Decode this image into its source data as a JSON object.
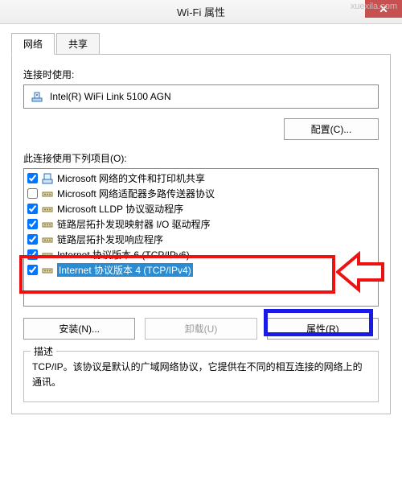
{
  "watermark": "xuexila.com",
  "titlebar": {
    "title": "Wi-Fi 属性"
  },
  "tabs": {
    "network": "网络",
    "sharing": "共享"
  },
  "connect_using_label": "连接时使用:",
  "adapter": {
    "name": "Intel(R) WiFi Link 5100 AGN"
  },
  "configure_btn": "配置(C)...",
  "items_label": "此连接使用下列项目(O):",
  "items": [
    {
      "checked": true,
      "label": "Microsoft 网络的文件和打印机共享",
      "icon": "share"
    },
    {
      "checked": false,
      "label": "Microsoft 网络适配器多路传送器协议",
      "icon": "proto"
    },
    {
      "checked": true,
      "label": "Microsoft LLDP 协议驱动程序",
      "icon": "proto"
    },
    {
      "checked": true,
      "label": "链路层拓扑发现映射器 I/O 驱动程序",
      "icon": "proto"
    },
    {
      "checked": true,
      "label": "链路层拓扑发现响应程序",
      "icon": "proto"
    },
    {
      "checked": true,
      "label": "Internet 协议版本 6 (TCP/IPv6)",
      "icon": "proto"
    },
    {
      "checked": true,
      "label": "Internet 协议版本 4 (TCP/IPv4)",
      "icon": "proto",
      "selected": true
    }
  ],
  "install_btn": "安装(N)...",
  "uninstall_btn": "卸载(U)",
  "properties_btn": "属性(R)",
  "description": {
    "legend": "描述",
    "text": "TCP/IP。该协议是默认的广域网络协议，它提供在不同的相互连接的网络上的通讯。"
  }
}
